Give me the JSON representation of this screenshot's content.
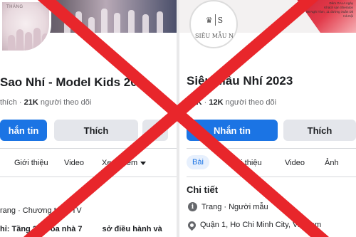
{
  "left_page": {
    "cover_brand": "THÁNG",
    "page_name": "Sao Nhí - Model Kids 202",
    "stats_prefix": "thích",
    "followers_count": "21K",
    "followers_label": "người theo dõi",
    "message_button": "hắn tin",
    "like_button": "Thích",
    "more_button": "•••",
    "tabs": {
      "intro": "Giới thiệu",
      "video": "Video",
      "more": "Xem thêm"
    },
    "detail_row_1": "rang · Chương trình TV",
    "detail_row_2": "hỉ: Tầng 26, Tòa nhà 7",
    "detail_row_2_tail": "sở điều hành và"
  },
  "right_page": {
    "logo_letter": "S",
    "logo_text": "SIÊU MẪU N",
    "info_lines": [
      "Đêm GALA ngày",
      "Khách sạn Sheraton",
      "88 Nghi Tàm, 11 đường Xuân Diệ",
      "Hà Nội"
    ],
    "page_name": "Siêu Mẫu Nhí 2023",
    "likes_count": "11K",
    "followers_count": "12K",
    "followers_label": "người theo dõi",
    "message_button": "Nhắn tin",
    "like_button": "Thích",
    "tabs": {
      "posts": "Bài",
      "intro": "Giới thiệu",
      "video": "Video",
      "photos": "Ảnh"
    },
    "section_title": "Chi tiết",
    "detail_row_1": "Trang · Người mẫu",
    "detail_row_2": "Quận 1, Ho Chi Minh City, Vietnam"
  },
  "overlay": {
    "mark": "red-x",
    "color": "#e8262b"
  },
  "colors": {
    "facebook_blue": "#1b74e4",
    "button_grey": "#e4e6eb",
    "text_dark": "#1c1e21",
    "text_muted": "#65676b"
  }
}
